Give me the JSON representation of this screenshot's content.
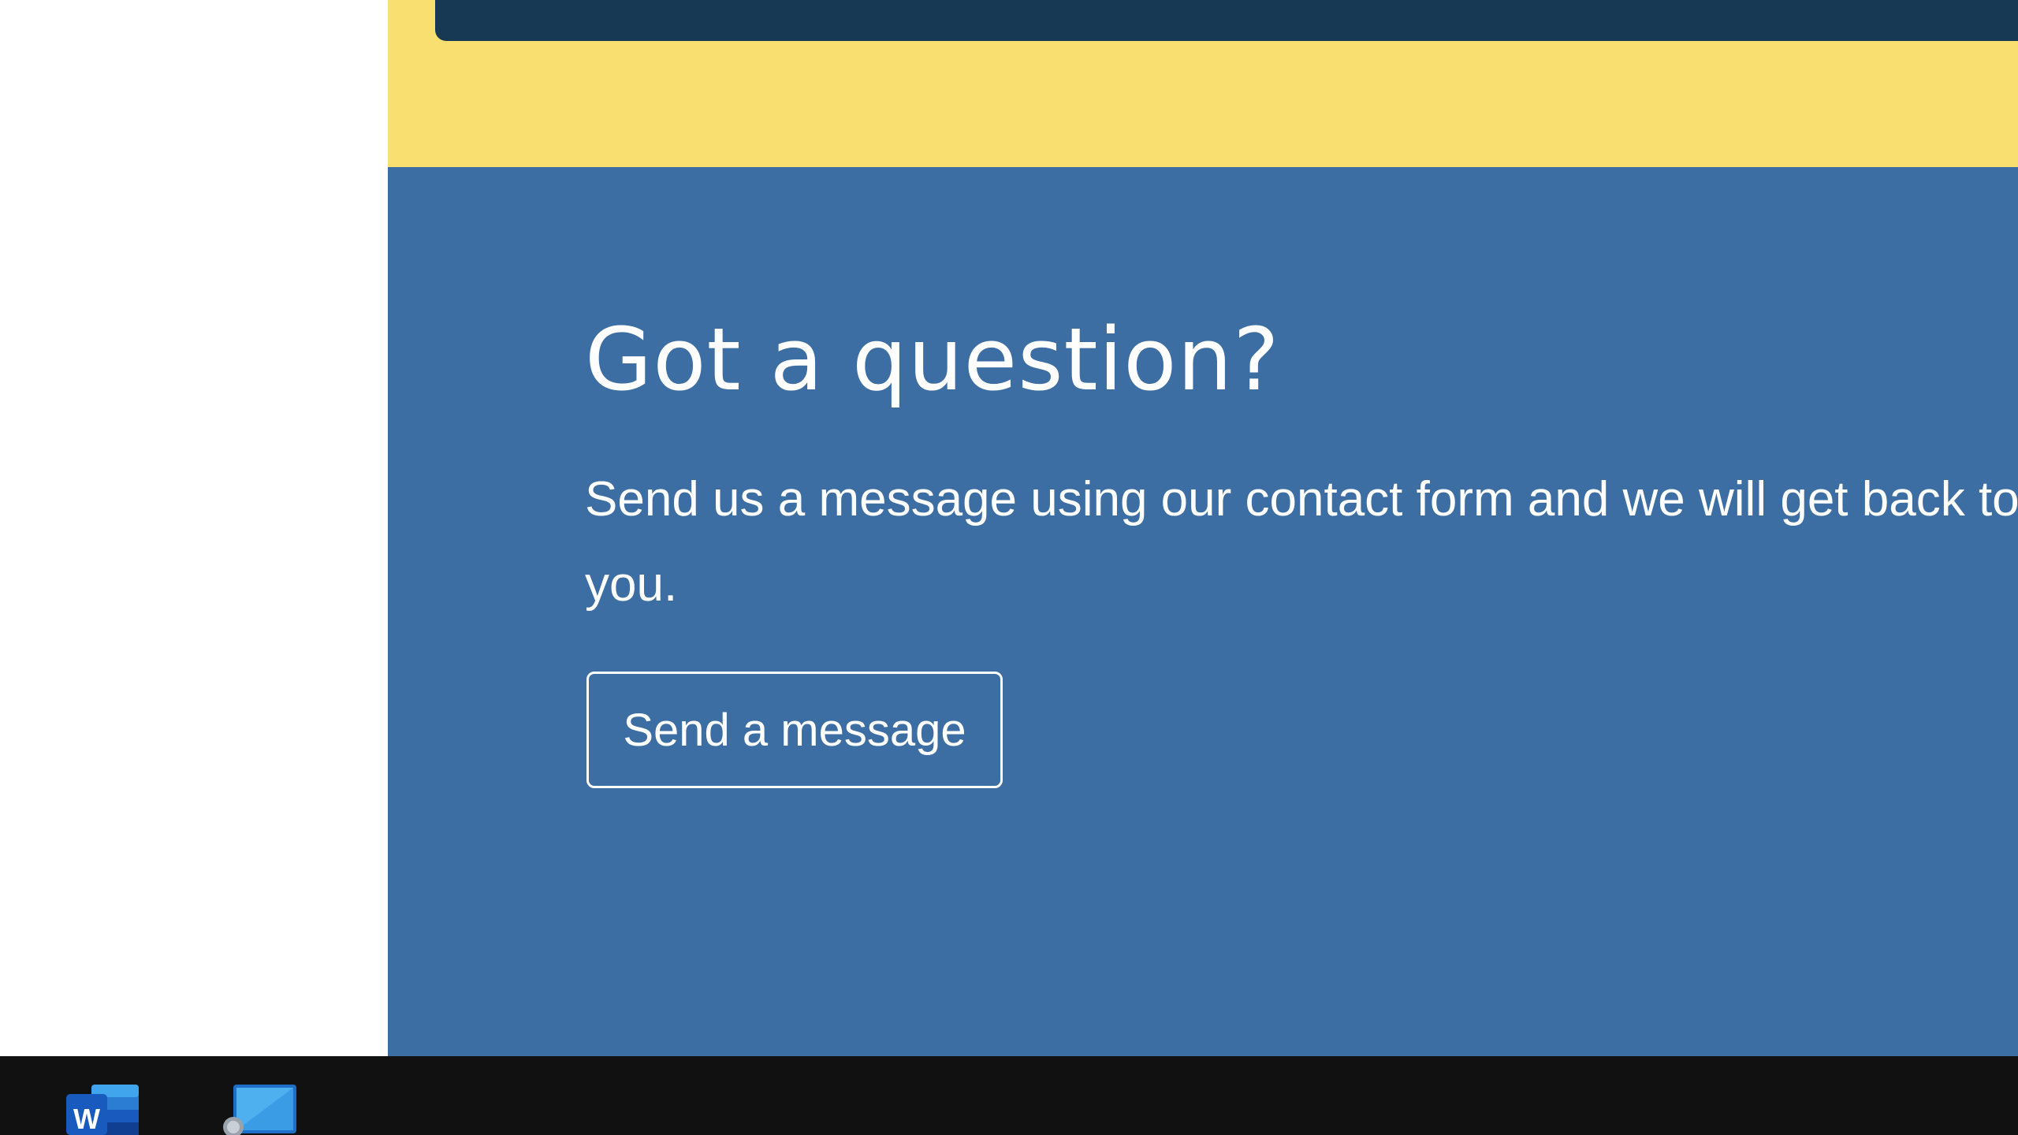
{
  "contact_section": {
    "heading": "Got a question?",
    "description": "Send us a message using our contact form and we will get back to you.",
    "button_label": "Send a message"
  },
  "taskbar": {
    "apps": [
      {
        "name": "Microsoft Word",
        "icon": "word-icon"
      },
      {
        "name": "Remote Desktop Connection",
        "icon": "remote-desktop-icon"
      }
    ]
  },
  "colors": {
    "yellow_band": "#f9df6f",
    "dark_navy_bar": "#173954",
    "section_blue": "#3d6ea3",
    "taskbar": "#111111",
    "text": "#ffffff"
  }
}
